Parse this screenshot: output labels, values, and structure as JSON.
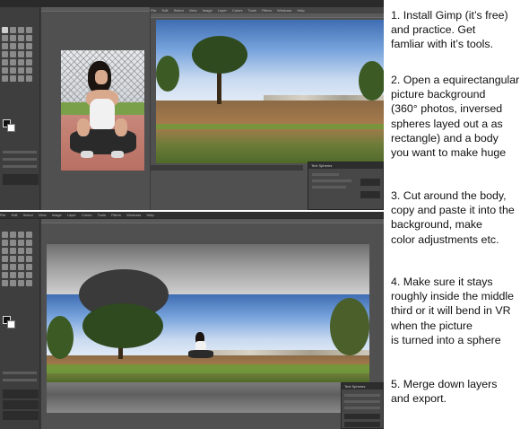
{
  "steps": [
    {
      "text": "1. Install Gimp (it’s free)\nand practice. Get\nfamliar with it’s tools."
    },
    {
      "text": "2. Open a equirectangular\npicture background\n(360° photos, inversed\nspheres layed out a as\nrectangle) and a body\nyou want to make huge"
    },
    {
      "text": "3. Cut around the body,\ncopy and paste it into the\nbackground, make\ncolor adjustments etc."
    },
    {
      "text": "4. Make sure it stays\nroughly inside the middle\nthird or it will bend in VR\nwhen the picture\nis turned into a sphere"
    },
    {
      "text": "5. Merge down layers\nand export."
    }
  ],
  "gimp_top": {
    "menu": [
      "File",
      "Edit",
      "Select",
      "View",
      "Image",
      "Layer",
      "Colors",
      "Tools",
      "Filters",
      "Windows",
      "Help"
    ],
    "dialog_title": "Text Spheres"
  },
  "gimp_bottom": {
    "menu": [
      "File",
      "Edit",
      "Select",
      "View",
      "Image",
      "Layer",
      "Colors",
      "Tools",
      "Filters",
      "Windows",
      "Help"
    ],
    "dialog_title": "Text Spheres"
  },
  "colors": {
    "gimp_dark": "#3b3b3b",
    "sky_blue": "#77a3dc",
    "grass_green": "#6f9b3a"
  }
}
